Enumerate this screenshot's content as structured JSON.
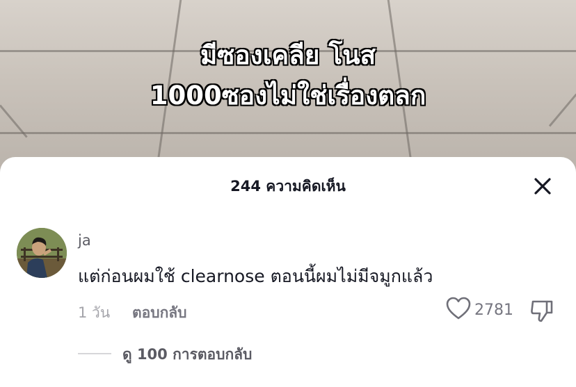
{
  "video": {
    "overlay_line1": "มีซองเคลีย โนส",
    "overlay_line2": "1000ซองไม่ใช่เรื่องตลก"
  },
  "comments_sheet": {
    "title": "244 ความคิดเห็น",
    "close_icon": "close-icon",
    "comment": {
      "username": "ja",
      "text": "แต่ก่อนผมใช้ clearnose ตอนนี้ผมไม่มีจมูกแล้ว",
      "time": "1 วัน",
      "reply_label": "ตอบกลับ",
      "like_count": "2781",
      "view_replies": "ดู 100 การตอบกลับ"
    }
  }
}
